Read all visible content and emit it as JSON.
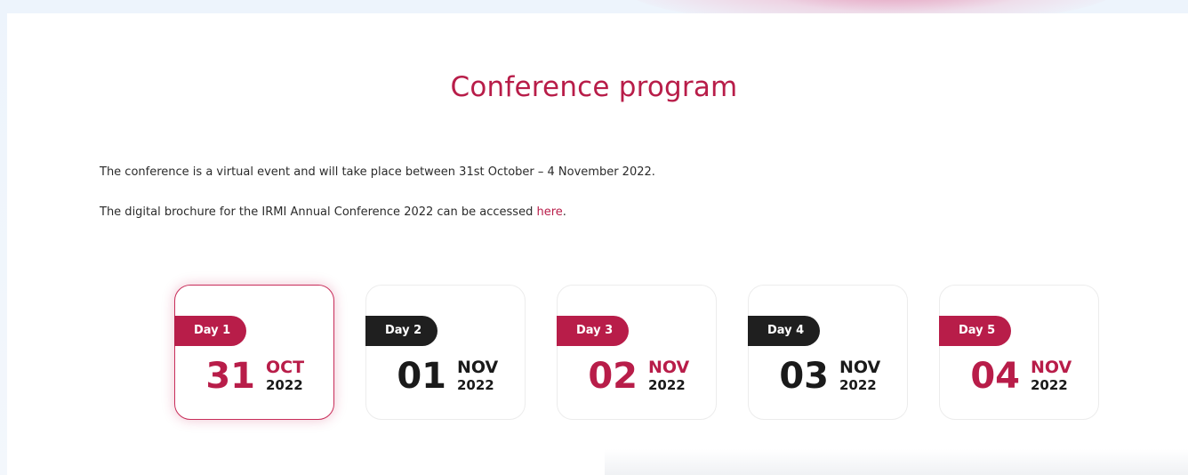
{
  "section": {
    "title": "Conference program"
  },
  "intro": {
    "line1": "The conference is a virtual event and will take place between 31st October – 4 November 2022.",
    "line2_prefix": "The digital brochure for the IRMI Annual Conference 2022 can be accessed ",
    "line2_link": "here",
    "line2_suffix": "."
  },
  "days": [
    {
      "label": "Day 1",
      "day": "31",
      "month": "OCT",
      "year": "2022",
      "active": true
    },
    {
      "label": "Day 2",
      "day": "01",
      "month": "NOV",
      "year": "2022",
      "active": false
    },
    {
      "label": "Day 3",
      "day": "02",
      "month": "NOV",
      "year": "2022",
      "active": false
    },
    {
      "label": "Day 4",
      "day": "03",
      "month": "NOV",
      "year": "2022",
      "active": false
    },
    {
      "label": "Day 5",
      "day": "04",
      "month": "NOV",
      "year": "2022",
      "active": false
    }
  ],
  "colors": {
    "accent": "#b81d49",
    "dark": "#1f1f1f",
    "background": "#eef4fb"
  }
}
